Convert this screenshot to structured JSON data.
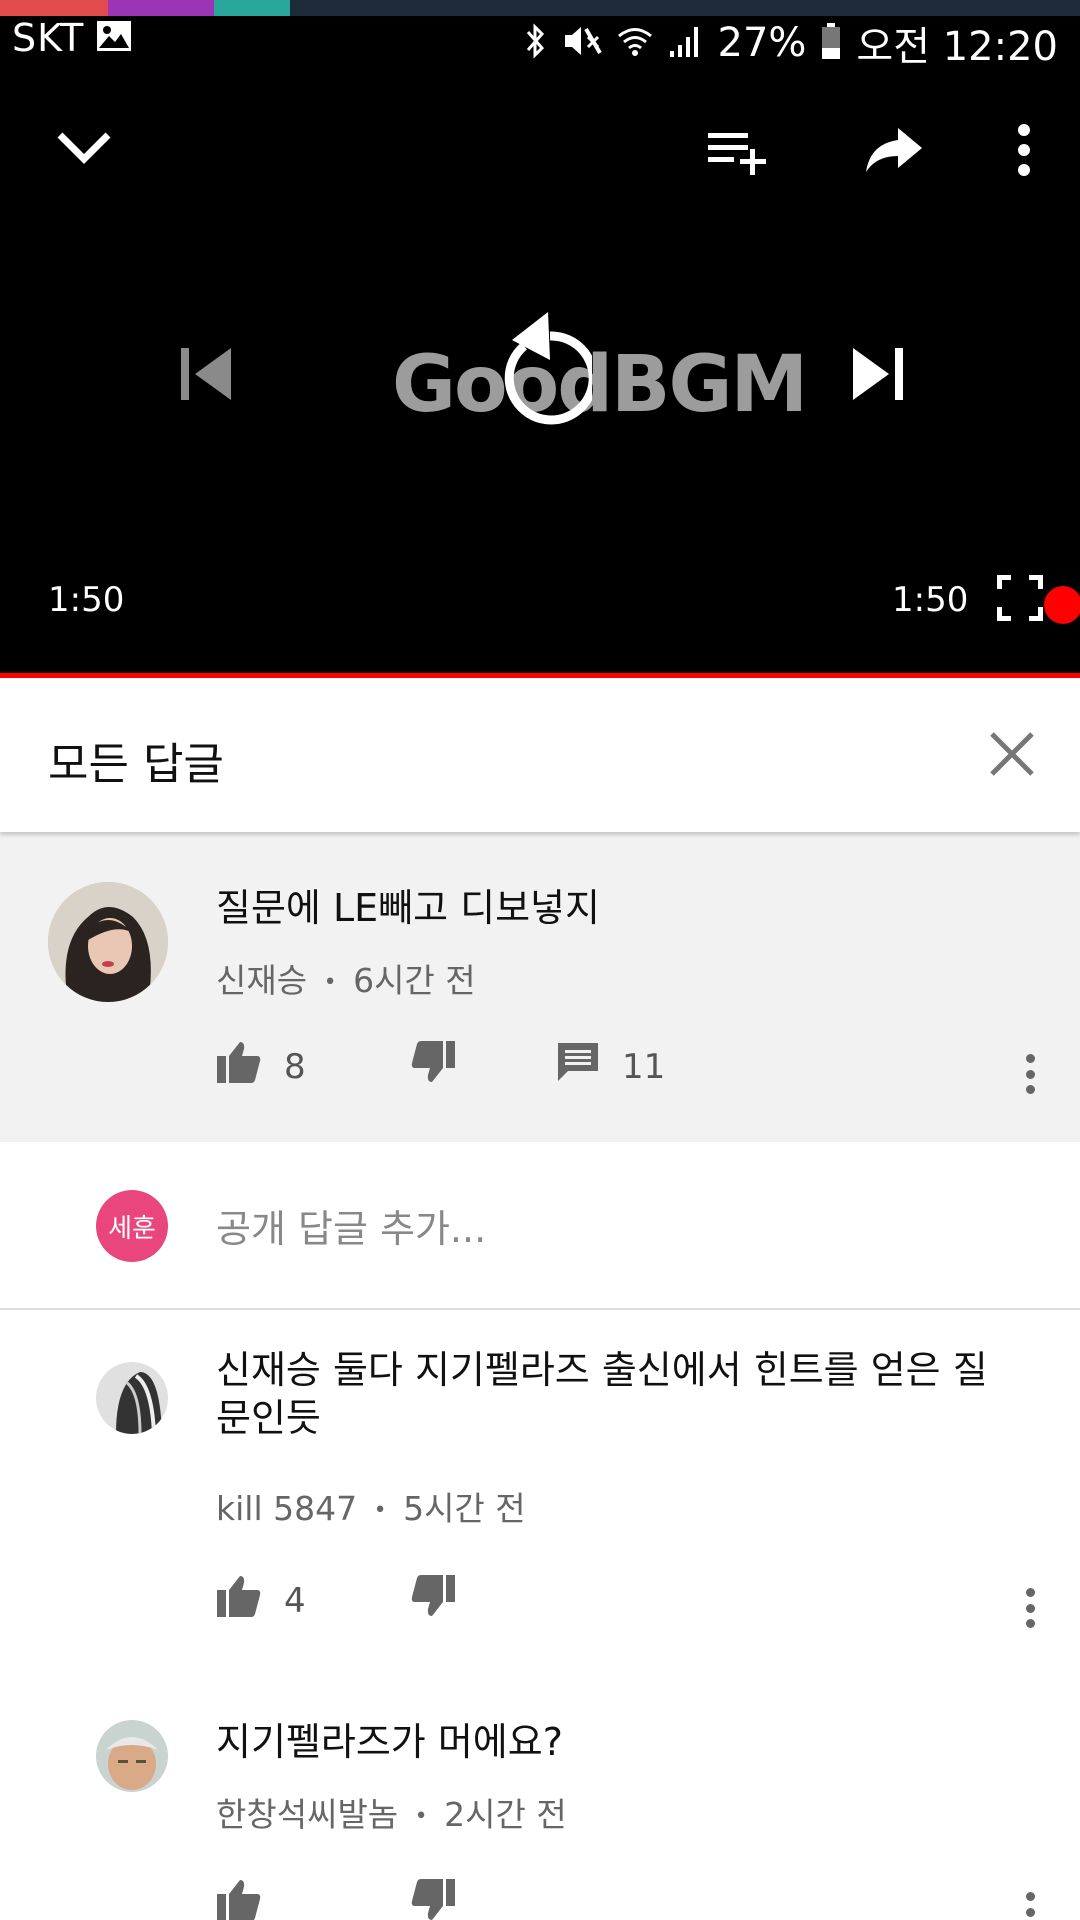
{
  "status_bar": {
    "carrier": "SKT",
    "battery": "27%",
    "time": "오전 12:20",
    "tint_colors": [
      "#e24b4b",
      "#9b35b5",
      "#2aa79b"
    ]
  },
  "player": {
    "logo_text": "GoodBGM",
    "current_time": "1:50",
    "duration": "1:50",
    "progress_percent": 100,
    "accent": "#ff0000"
  },
  "header": {
    "title": "모든 답글"
  },
  "main_comment": {
    "text": "질문에 LE빼고 디보넣지",
    "author": "신재승",
    "time": "6시간 전",
    "likes": "8",
    "replies": "11"
  },
  "add_reply": {
    "avatar_label": "세훈",
    "placeholder": "공개 답글 추가..."
  },
  "replies": [
    {
      "text": "신재승 둘다 지기펠라즈 출신에서 힌트를 얻은 질문인듯",
      "author": "kill 5847",
      "time": "5시간 전",
      "likes": "4"
    },
    {
      "text": "지기펠라즈가 머에요?",
      "author": "한창석씨발놈",
      "time": "2시간 전",
      "likes": ""
    }
  ],
  "meta_separator": "•",
  "icons": [
    "collapse-chevron-icon",
    "add-to-playlist-icon",
    "share-icon",
    "more-vert-icon",
    "previous-icon",
    "replay-icon",
    "next-icon",
    "fullscreen-icon",
    "close-icon",
    "thumb-up-icon",
    "thumb-down-icon",
    "comment-icon"
  ]
}
